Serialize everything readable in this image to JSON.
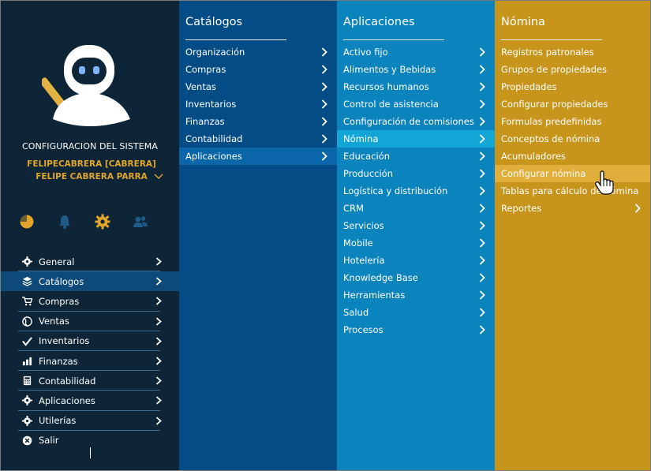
{
  "sidebar": {
    "system_title": "CONFIGURACION DEL SISTEMA",
    "user_account": "FELIPECABRERA [CABRERA]",
    "user_name": "FELIPE CABRERA PARRA",
    "quick_icons": [
      "pie-chart-icon",
      "bell-icon",
      "gear-icon",
      "users-icon"
    ],
    "nav": [
      {
        "label": "General",
        "icon": "gear-icon"
      },
      {
        "label": "Catálogos",
        "icon": "layers-icon",
        "active": true
      },
      {
        "label": "Compras",
        "icon": "cart-icon"
      },
      {
        "label": "Ventas",
        "icon": "globe-icon"
      },
      {
        "label": "Inventarios",
        "icon": "check-icon"
      },
      {
        "label": "Finanzas",
        "icon": "bar-chart-icon"
      },
      {
        "label": "Contabilidad",
        "icon": "calculator-icon"
      },
      {
        "label": "Aplicaciones",
        "icon": "gear-icon"
      },
      {
        "label": "Utilerías",
        "icon": "gear-icon"
      },
      {
        "label": "Salir",
        "icon": "close-circle-icon"
      }
    ]
  },
  "catalogos": {
    "title": "Catálogos",
    "items": [
      "Organización",
      "Compras",
      "Ventas",
      "Inventarios",
      "Finanzas",
      "Contabilidad",
      "Aplicaciones"
    ],
    "active_index": 6
  },
  "aplicaciones": {
    "title": "Aplicaciones",
    "items": [
      "Activo fijo",
      "Alimentos y Bebidas",
      "Recursos humanos",
      "Control de asistencia",
      "Configuración de comisiones",
      "Nómina",
      "Educación",
      "Producción",
      "Logística y distribución",
      "CRM",
      "Servicios",
      "Mobile",
      "Hotelería",
      "Knowledge Base",
      "Herramientas",
      "Salud",
      "Procesos"
    ],
    "active_index": 5
  },
  "nomina": {
    "title": "Nómina",
    "items": [
      "Registros patronales",
      "Grupos de propiedades",
      "Propiedades",
      "Configurar propiedades",
      "Formulas predefinidas",
      "Conceptos de nómina",
      "Acumuladores",
      "Configurar nómina",
      "Tablas para cálculo de nómina",
      "Reportes"
    ],
    "active_index": 7,
    "submenu_index": 9
  },
  "colors": {
    "sidebar": "#0d2537",
    "catalogos": "#034c86",
    "aplicaciones": "#0b83bd",
    "nomina": "#c7951b",
    "accent": "#e0a52a"
  }
}
